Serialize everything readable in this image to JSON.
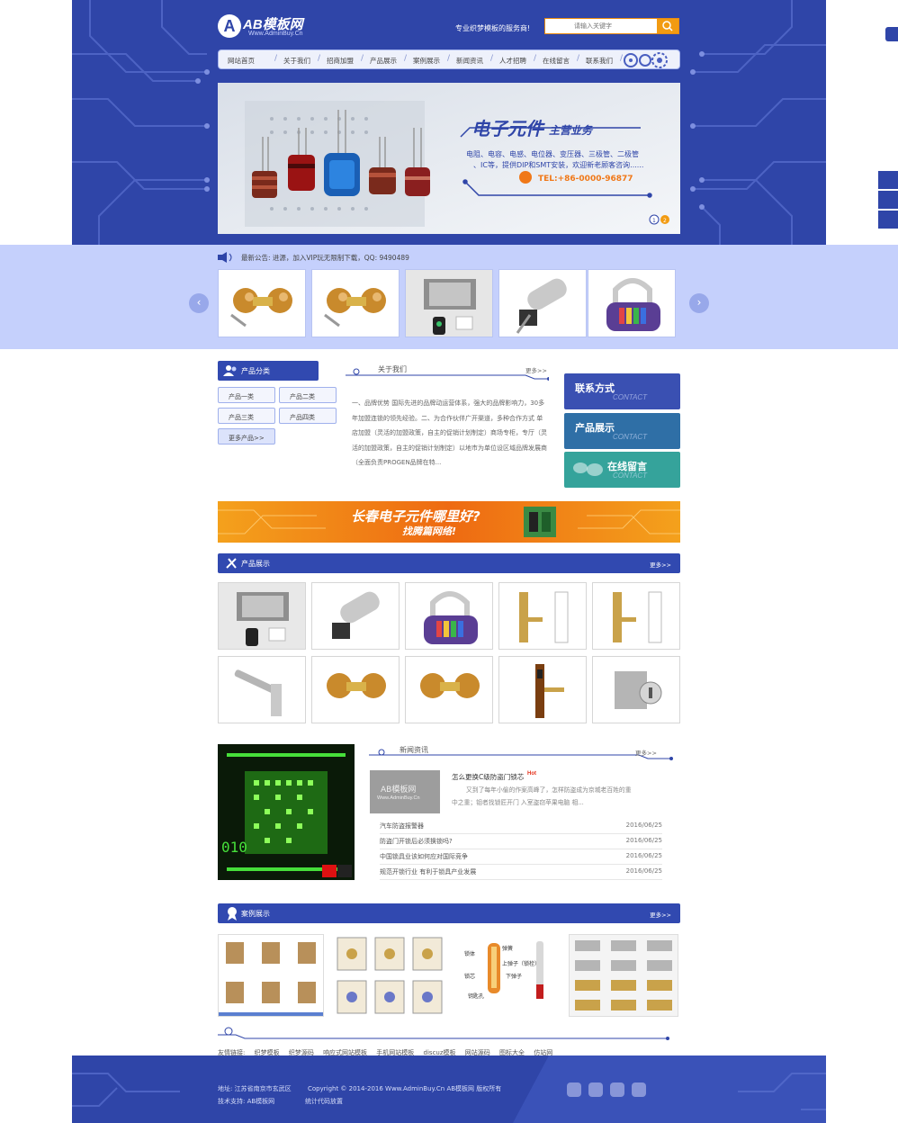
{
  "brand": {
    "name": "AB模板网",
    "url": "Www.AdminBuy.Cn",
    "mark": "A"
  },
  "header": {
    "slogan": "专业织梦模板的服务商!",
    "search_placeholder": "请输入关键字"
  },
  "nav": [
    "网站首页",
    "关于我们",
    "招商加盟",
    "产品展示",
    "案例展示",
    "新闻资讯",
    "人才招聘",
    "在线留言",
    "联系我们"
  ],
  "banner": {
    "title": "电子元件",
    "title_small": "主营业务",
    "desc1": "电阻、电容、电感、电位器、变压器、三极管、二极管",
    "desc2": "、IC等，提供DIP和SMT安装，欢迎新老顾客咨询......",
    "tel": "TEL:+86-0000-96877",
    "dots": [
      "1",
      "2"
    ]
  },
  "notice": "最新公告: 进源，加入VIP玩无限制下载，QQ: 9490489",
  "arrows": {
    "prev": "‹",
    "next": "›"
  },
  "categories": {
    "title": "产品分类",
    "items": [
      "产品一类",
      "产品二类",
      "产品三类",
      "产品四类"
    ],
    "more": "更多产品>>"
  },
  "about": {
    "title": "关于我们",
    "more": "更多>>",
    "text": "一、品牌优势 国际先进的品牌动运营体系，强大的品牌影响力，30多年加盟连锁的领先经验。二、为合作伙伴广开渠道，多种合作方式 单店加盟（灵活的加盟政策，自主的促销计划制定）商场专柜，专厅（灵活的加盟政策，自主的促销计划制定）以地市为单位设区域品牌发展商（全面负责PROGEN品牌在特..."
  },
  "side_cards": [
    {
      "title": "联系方式",
      "en": "CONTACT",
      "color": "#3a50b2"
    },
    {
      "title": "产品展示",
      "en": "CONTACT",
      "color": "#2f6fa6"
    },
    {
      "title": "在线留言",
      "en": "CONTACT",
      "color": "#35a39b"
    }
  ],
  "ad": {
    "line1": "长春电子元件哪里好?",
    "line2": "找腾篇网络!"
  },
  "products": {
    "title": "产品展示",
    "more": "更多>>"
  },
  "news": {
    "title": "新闻资讯",
    "more": "更多>>",
    "thumb_text": "AB模板网",
    "thumb_sub": "Www.AdminBuy.Cn",
    "featured_title": "怎么更换C级防盗门锁芯",
    "hot": "Hot",
    "featured_desc1": "又到了每年小偷的作案高峰了，怎样防盗成为京城老百姓的重",
    "featured_desc2": "中之重；钼者找锁匠开门 入室盗窃苹果电脑 相...",
    "items": [
      {
        "title": "汽车防盗报警器",
        "date": "2016/06/25"
      },
      {
        "title": "防盗门开锁后必须换锁吗?",
        "date": "2016/06/25"
      },
      {
        "title": "中国锁具业该如何应对国际竞争",
        "date": "2016/06/25"
      },
      {
        "title": "规范开锁行业 有利于锁具产业发展",
        "date": "2016/06/25"
      }
    ]
  },
  "cases": {
    "title": "案例展示",
    "more": "更多>>",
    "diagram_labels": [
      "弹簧",
      "锁体",
      "上弹子（锁栓）",
      "锁芯",
      "下弹子",
      "钥匙孔"
    ]
  },
  "links": {
    "label": "友情链接:",
    "items": [
      "织梦模板",
      "织梦源码",
      "响应式网站模板",
      "手机网站模板",
      "discuz模板",
      "网站源码",
      "图标大全",
      "仿站网"
    ]
  },
  "footer": {
    "address": "地址: 江苏省南京市玄武区",
    "copyright": "Copyright © 2014-2016 Www.AdminBuy.Cn AB模板网 版权所有",
    "support": "技术支持: AB模板网",
    "stats": "统计代码放置"
  },
  "colors": {
    "primary": "#2f45a8",
    "band": "#c5d0fc",
    "accent": "#f29b12"
  }
}
